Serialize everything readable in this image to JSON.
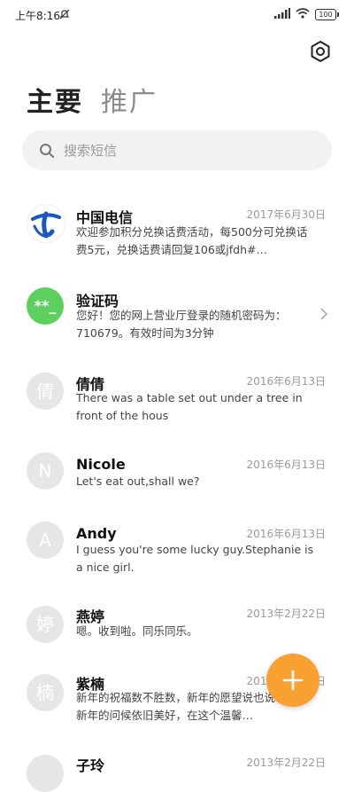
{
  "status": {
    "time": "上午8:16",
    "battery": "100"
  },
  "tabs": [
    {
      "label": "主要"
    },
    {
      "label": "推广"
    }
  ],
  "search": {
    "placeholder": "搜索短信"
  },
  "messages": [
    {
      "name": "中国电信",
      "date": "2017年6月30日",
      "snippet": "欢迎参加积分兑换话费活动，每500分可兑换话费5元，兑换话费请回复106或jfdh#…",
      "avatar": "telecom-logo"
    },
    {
      "name": "验证码",
      "date": "",
      "snippet": "您好！您的网上营业厅登录的随机密码为：710679。有效时间为3分钟",
      "avatar_text": "**_",
      "avatar_color": "#5ccf5c"
    },
    {
      "name": "倩倩",
      "date": "2016年6月13日",
      "snippet": "There was a table set out under a tree in front of the hous",
      "avatar_text": "倩"
    },
    {
      "name": "Nicole",
      "date": "2016年6月13日",
      "snippet": "Let's eat out,shall we?",
      "avatar_text": "N"
    },
    {
      "name": "Andy",
      "date": "2016年6月13日",
      "snippet": "I guess you're some lucky guy.Stephanie is a nice girl.",
      "avatar_text": "A"
    },
    {
      "name": "燕婷",
      "date": "2013年2月22日",
      "snippet": "嗯。收到啦。同乐同乐。",
      "avatar_text": "婷"
    },
    {
      "name": "紫楠",
      "date": "2013年2月22日",
      "snippet": "新年的祝福数不胜数，新年的愿望说也说不多，新年的问候依旧美好，在这个温馨…",
      "avatar_text": "楠"
    },
    {
      "name": "子玲",
      "date": "2013年2月22日",
      "snippet": "",
      "avatar_text": ""
    }
  ],
  "colors": {
    "accent": "#f9a130",
    "telecom_blue": "#1a56c4",
    "verify_green": "#5ccf5c"
  }
}
